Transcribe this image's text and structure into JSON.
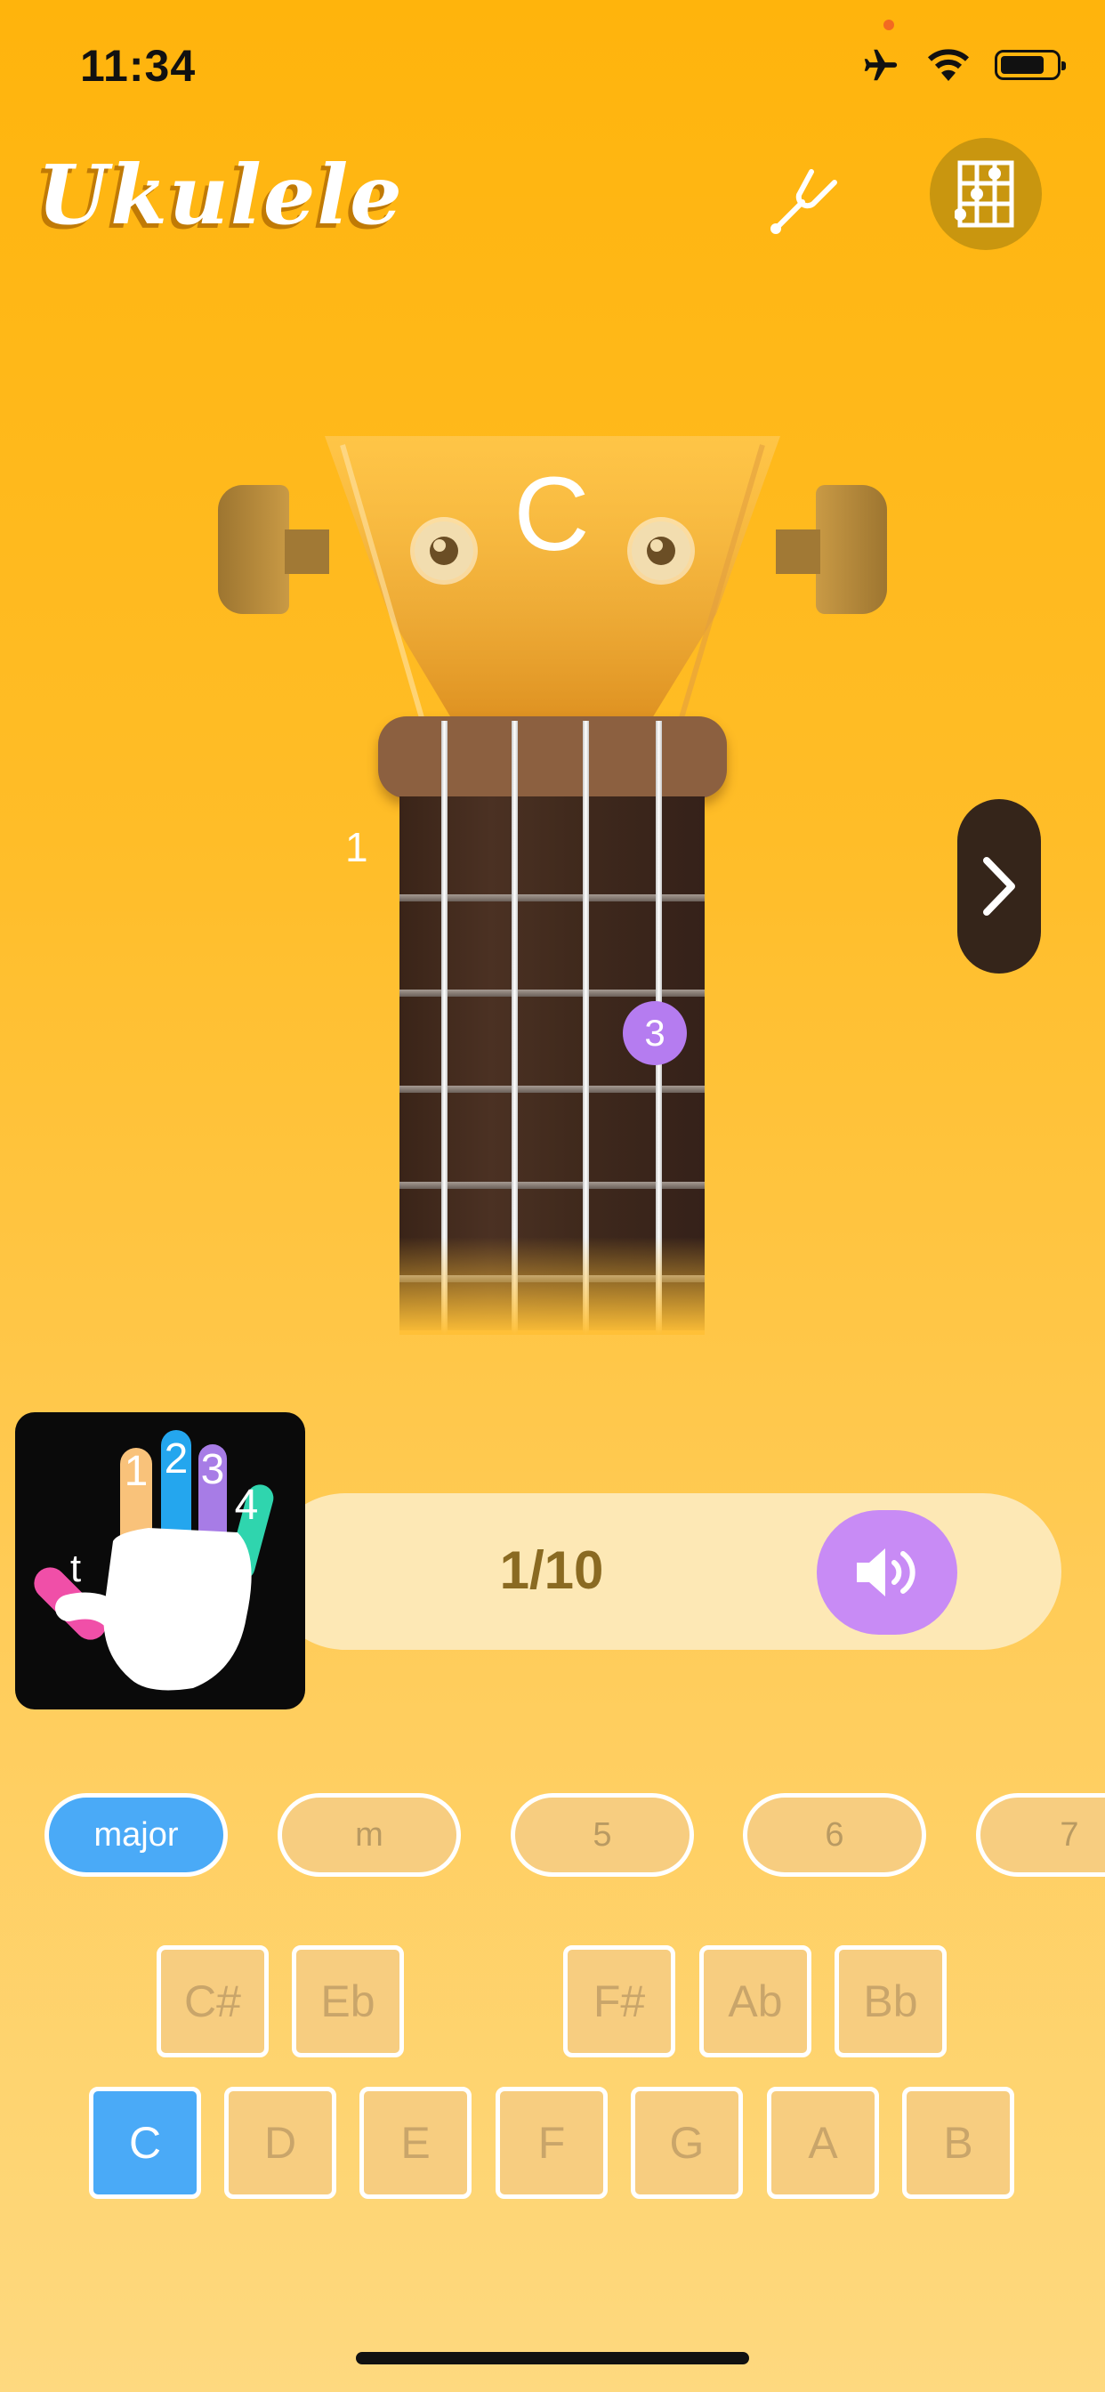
{
  "status_bar": {
    "time": "11:34",
    "icons": [
      "airplane-icon",
      "wifi-icon",
      "battery-icon"
    ]
  },
  "header": {
    "app_title": "Ukulele",
    "tuner_icon": "tuning-fork-icon",
    "chord_chart_icon": "chord-chart-icon"
  },
  "chord_display": {
    "chord_name": "C",
    "fret_number": "1",
    "finger_number": "3"
  },
  "hand_legend": {
    "fingers": [
      "t",
      "1",
      "2",
      "3",
      "4"
    ]
  },
  "player": {
    "progress": "1/10",
    "sound_icon": "speaker-icon",
    "next_icon": "chevron-right-icon"
  },
  "qualities": [
    {
      "label": "major",
      "active": true
    },
    {
      "label": "m",
      "active": false
    },
    {
      "label": "5",
      "active": false
    },
    {
      "label": "6",
      "active": false
    },
    {
      "label": "7",
      "active": false
    }
  ],
  "sharp_keys": [
    "C#",
    "Eb",
    "F#",
    "Ab",
    "Bb"
  ],
  "natural_keys": [
    "C",
    "D",
    "E",
    "F",
    "G",
    "A",
    "B"
  ],
  "selected_key": "C",
  "colors": {
    "background_top": "#FFB40C",
    "accent_blue": "#4AAAF7",
    "accent_purple": "#C88BF5",
    "fretboard": "#3F291C"
  }
}
